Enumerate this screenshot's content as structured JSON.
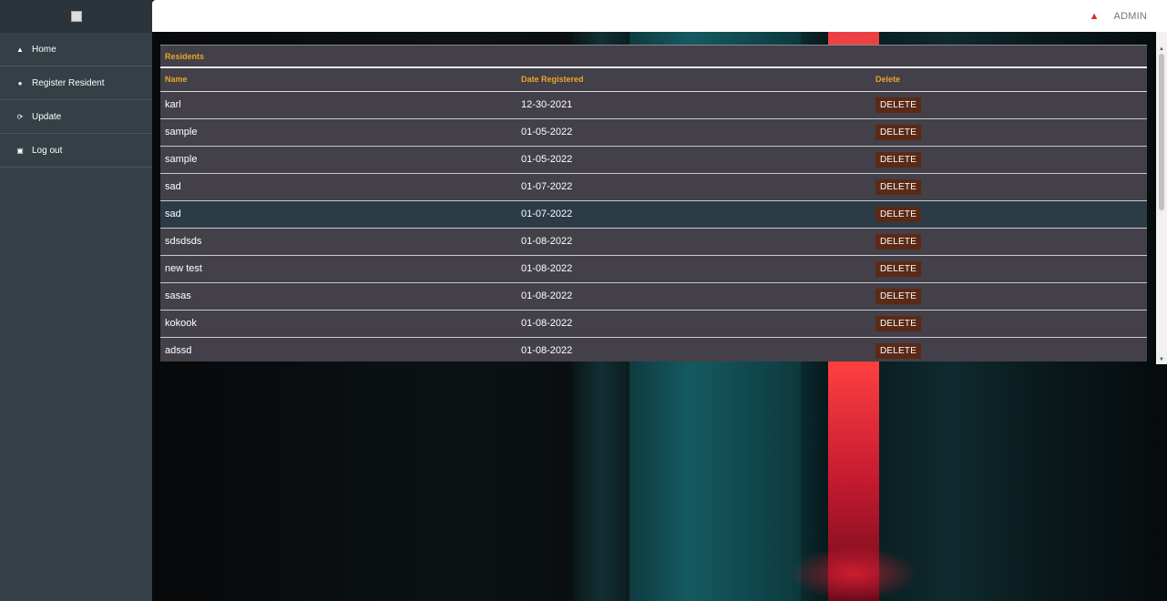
{
  "user": {
    "name": "ADMIN"
  },
  "sidebar": {
    "items": [
      {
        "label": "Home",
        "icon": "home-icon"
      },
      {
        "label": "Register Resident",
        "icon": "users-icon"
      },
      {
        "label": "Update",
        "icon": "refresh-icon"
      },
      {
        "label": "Log out",
        "icon": "logout-icon"
      }
    ]
  },
  "table": {
    "title": "Residents",
    "headers": [
      "Name",
      "Date Registered",
      "Delete"
    ],
    "delete_label": "DELETE",
    "rows": [
      {
        "name": "karl",
        "date": "12-30-2021"
      },
      {
        "name": "sample",
        "date": "01-05-2022"
      },
      {
        "name": "sample",
        "date": "01-05-2022"
      },
      {
        "name": "sad",
        "date": "01-07-2022"
      },
      {
        "name": "sad",
        "date": "01-07-2022"
      },
      {
        "name": "sdsdsds",
        "date": "01-08-2022"
      },
      {
        "name": "new test",
        "date": "01-08-2022"
      },
      {
        "name": "sasas",
        "date": "01-08-2022"
      },
      {
        "name": "kokook",
        "date": "01-08-2022"
      },
      {
        "name": "adssd",
        "date": "01-08-2022"
      }
    ]
  },
  "colors": {
    "accent": "#e8a624",
    "sidebar": "#343f46",
    "delete_button": "#5a2a16",
    "notification": "#d03030"
  }
}
